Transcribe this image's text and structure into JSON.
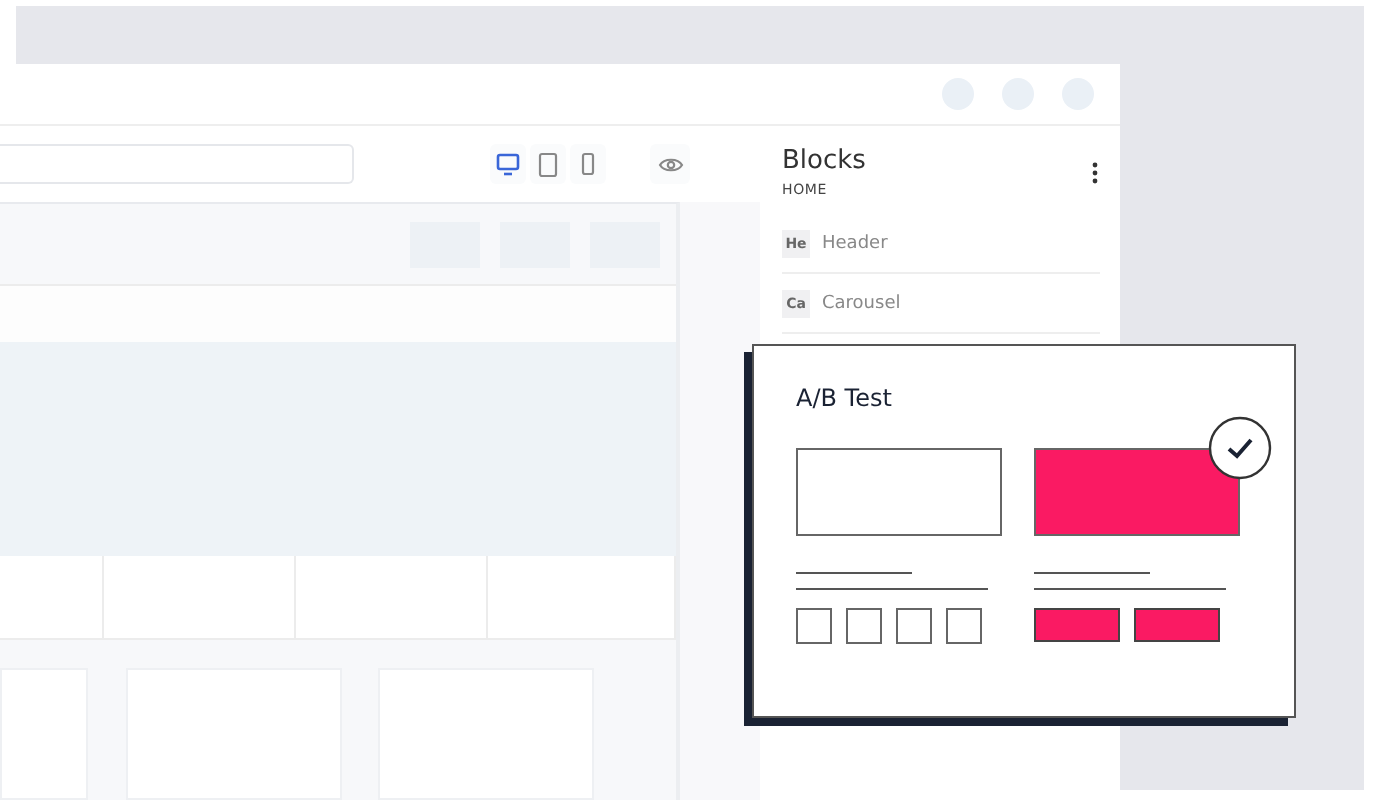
{
  "toolbar": {
    "devices": [
      {
        "kind": "desktop",
        "selected": true
      },
      {
        "kind": "tablet",
        "selected": false
      },
      {
        "kind": "phone",
        "selected": false
      }
    ]
  },
  "sidebar": {
    "title": "Blocks",
    "subtitle": "HOME",
    "items": [
      {
        "abbr": "He",
        "label": "Header"
      },
      {
        "abbr": "Ca",
        "label": "Carousel"
      }
    ]
  },
  "ab_card": {
    "title": "A/B Test",
    "variants": [
      {
        "selected": false
      },
      {
        "selected": true
      }
    ]
  }
}
